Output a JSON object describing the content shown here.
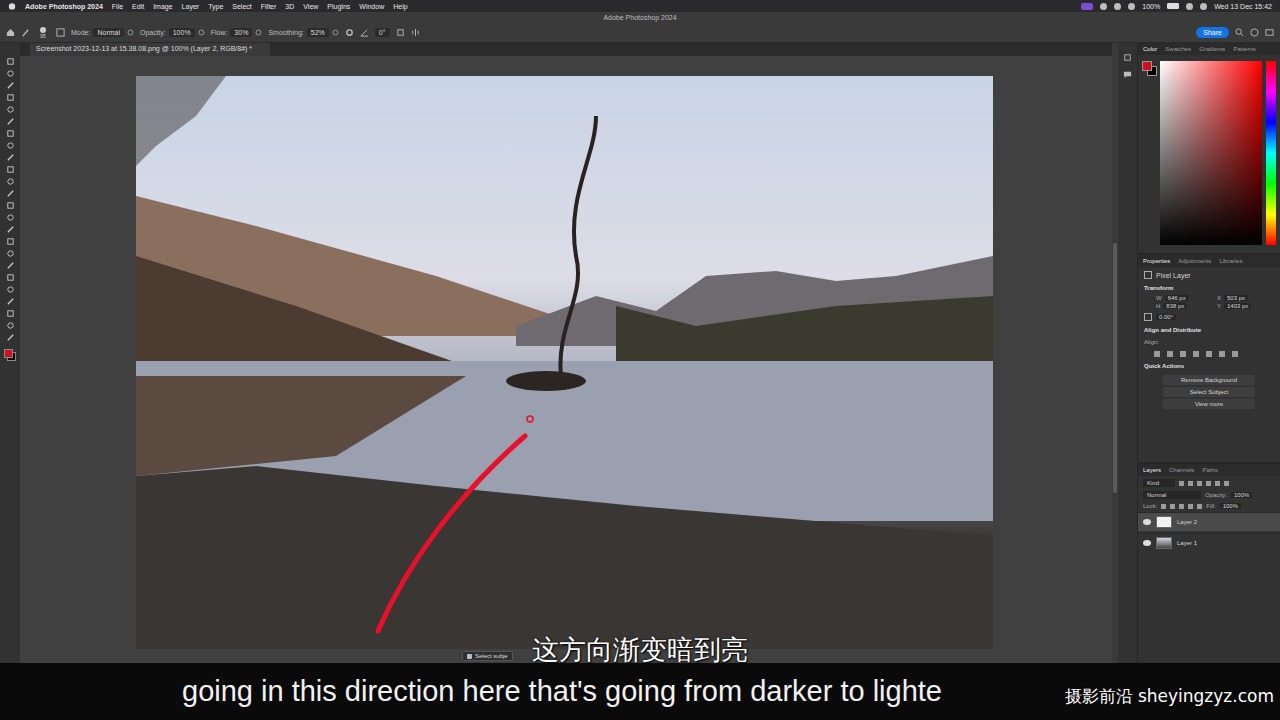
{
  "menubar": {
    "app": "Adobe Photoshop 2024",
    "items": [
      "File",
      "Edit",
      "Image",
      "Layer",
      "Type",
      "Select",
      "Filter",
      "3D",
      "View",
      "Plugins",
      "Window",
      "Help"
    ],
    "battery": "100%",
    "clock": "Wed 13 Dec 15:42"
  },
  "window": {
    "title": "Adobe Photoshop 2024"
  },
  "options_bar": {
    "brush_size": "95",
    "fields": [
      {
        "label": "Mode:",
        "value": "Normal"
      },
      {
        "label": "Opacity:",
        "value": "100%"
      },
      {
        "label": "Flow:",
        "value": "30%"
      },
      {
        "label": "Smoothing:",
        "value": "52%"
      }
    ],
    "angle": "0°",
    "share": "Share"
  },
  "document_tab": {
    "title": "Screenshot 2023-12-13 at 15.38.08.png @ 100% (Layer 2, RGB/8#) *"
  },
  "canvas": {
    "contextual_button": "Select subje"
  },
  "color_panel": {
    "tabs": [
      {
        "label": "Color",
        "selected": true
      },
      {
        "label": "Swatches",
        "selected": false
      },
      {
        "label": "Gradients",
        "selected": false
      },
      {
        "label": "Patterns",
        "selected": false
      }
    ]
  },
  "properties": {
    "tabs": [
      {
        "label": "Properties",
        "selected": true
      },
      {
        "label": "Adjustments",
        "selected": false
      },
      {
        "label": "Libraries",
        "selected": false
      }
    ],
    "layer_type": "Pixel Layer",
    "transform_title": "Transform",
    "fields": [
      {
        "label": "W",
        "value": "646 px"
      },
      {
        "label": "X",
        "value": "503 px"
      },
      {
        "label": "H",
        "value": "838 px"
      },
      {
        "label": "Y",
        "value": "1403 px"
      }
    ],
    "rotation": "0.00°",
    "align_title": "Align and Distribute",
    "align_label": "Align:",
    "quick_actions_title": "Quick Actions",
    "quick_actions": [
      "Remove Background",
      "Select Subject",
      "View more"
    ]
  },
  "layers": {
    "tabs": [
      {
        "label": "Layers",
        "selected": true
      },
      {
        "label": "Channels",
        "selected": false
      },
      {
        "label": "Paths",
        "selected": false
      }
    ],
    "filter": "Kind",
    "blend_mode": "Normal",
    "opacity_label": "Opacity:",
    "opacity": "100%",
    "lock_label": "Lock:",
    "fill_label": "Fill:",
    "fill": "100%",
    "items": [
      {
        "name": "Layer 2",
        "selected": true,
        "visible": true
      },
      {
        "name": "Layer 1",
        "selected": false,
        "visible": true
      }
    ]
  },
  "subtitles": {
    "zh": "这方向渐变暗到亮",
    "en": "going in this direction here that's going from darker to lighte"
  },
  "watermark": "摄影前沿 sheyingzyz.com"
}
